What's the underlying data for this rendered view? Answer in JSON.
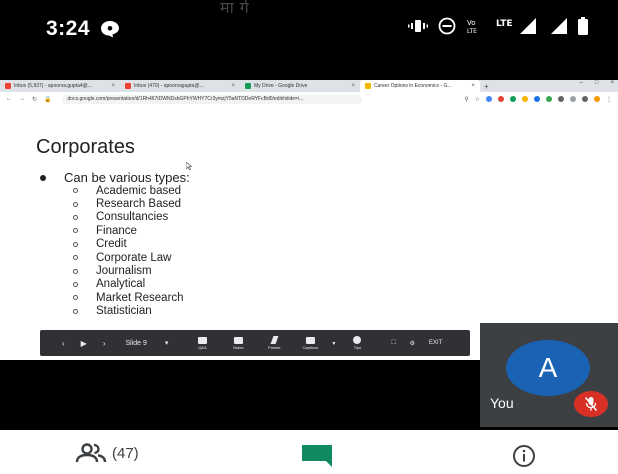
{
  "status_bar": {
    "time": "3:24",
    "watermark": "मार्ग"
  },
  "browser": {
    "tabs": [
      {
        "title": "Inbox (5,937) - apoorva.gupta4@...",
        "active": false,
        "favicon_color": "#ea4335"
      },
      {
        "title": "Inbox (470) - apoorvagupta@...",
        "active": false,
        "favicon_color": "#ea4335"
      },
      {
        "title": "My Drive - Google Drive",
        "active": false,
        "favicon_color": "#0f9d58"
      },
      {
        "title": "Career Options in Economics - G...",
        "active": true,
        "favicon_color": "#f4b400"
      }
    ],
    "url": "docs.google.com/presentation/d/1Rh467tDWNDsbGPhYWHY7Cr3ymzjY5aNTDDeRYFcBd0/edit#slide=i..."
  },
  "slide": {
    "title": "Corporates",
    "bullet": "Can be various types:",
    "items": [
      "Academic based",
      "Research Based",
      "Consultancies",
      "Finance",
      "Credit",
      "Corporate Law",
      "Journalism",
      "Analytical",
      "Market Research",
      "Statistician"
    ]
  },
  "toolbar": {
    "slide_label": "Slide 9",
    "tools": [
      {
        "label": "Q&A"
      },
      {
        "label": "Notes"
      },
      {
        "label": "Pointer"
      },
      {
        "label": "Captions"
      },
      {
        "label": "Tips"
      }
    ],
    "exit_label": "EXIT"
  },
  "self_view": {
    "avatar_letter": "A",
    "name": "You"
  },
  "bottom_bar": {
    "participants": "(47)"
  },
  "colors": {
    "avatar": "#1a62b3",
    "mic_off": "#d93025",
    "chat": "#0f8a5f"
  }
}
